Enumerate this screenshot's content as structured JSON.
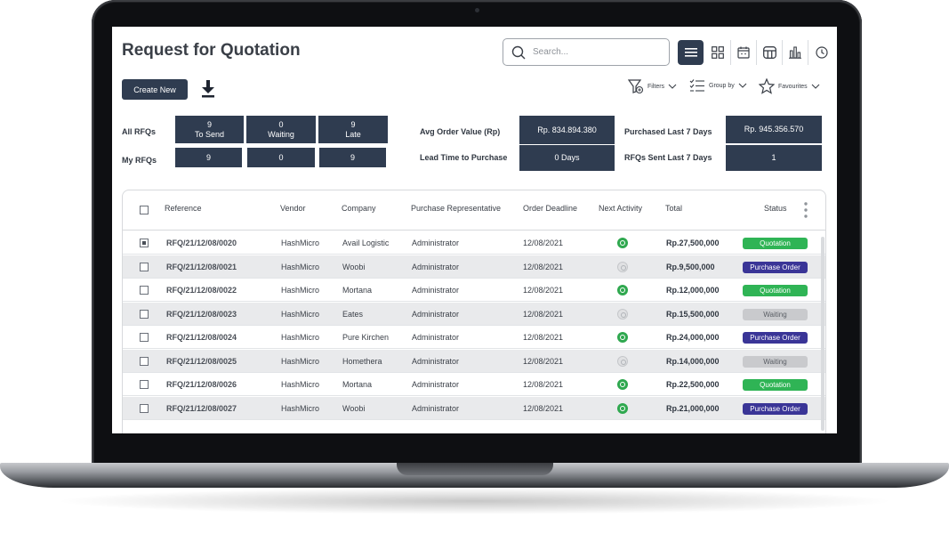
{
  "page": {
    "title": "Request for Quotation",
    "search": {
      "placeholder": "Search..."
    },
    "views": [
      "list-view",
      "kanban-view",
      "calendar-view",
      "pivot-view",
      "graph-view",
      "activity-view"
    ],
    "create_label": "Create New",
    "toolbar": {
      "filters": "Filters",
      "group_by": "Group by",
      "favourites": "Favourites"
    }
  },
  "kpis": {
    "all_rfqs_label": "All RFQs",
    "my_rfqs_label": "My RFQs",
    "all": [
      {
        "count": "9",
        "label": "To Send"
      },
      {
        "count": "0",
        "label": "Waiting"
      },
      {
        "count": "9",
        "label": "Late"
      }
    ],
    "mine": [
      "9",
      "0",
      "9"
    ],
    "avg_order_label": "Avg Order Value (Rp)",
    "avg_order_value": "Rp. 834.894.380",
    "lead_time_label": "Lead Time to Purchase",
    "lead_time_value": "0 Days",
    "purchased_label": "Purchased Last 7 Days",
    "purchased_value": "Rp. 945.356.570",
    "rfqs_sent_label": "RFQs Sent Last 7 Days",
    "rfqs_sent_value": "1"
  },
  "table": {
    "headers": {
      "reference": "Reference",
      "vendor": "Vendor",
      "company": "Company",
      "rep": "Purchase Representative",
      "deadline": "Order Deadline",
      "activity": "Next Activity",
      "total": "Total",
      "status": "Status"
    },
    "rows": [
      {
        "ref": "RFQ/21/12/08/0020",
        "vendor": "HashMicro",
        "company": "Avail Logistic",
        "rep": "Administrator",
        "deadline": "12/08/2021",
        "activity": "on",
        "total": "Rp.27,500,000",
        "status": "Quotation",
        "checked": true
      },
      {
        "ref": "RFQ/21/12/08/0021",
        "vendor": "HashMicro",
        "company": "Woobi",
        "rep": "Administrator",
        "deadline": "12/08/2021",
        "activity": "off",
        "total": "Rp.9,500,000",
        "status": "Purchase Order",
        "checked": false
      },
      {
        "ref": "RFQ/21/12/08/0022",
        "vendor": "HashMicro",
        "company": "Mortana",
        "rep": "Administrator",
        "deadline": "12/08/2021",
        "activity": "on",
        "total": "Rp.12,000,000",
        "status": "Quotation",
        "checked": false
      },
      {
        "ref": "RFQ/21/12/08/0023",
        "vendor": "HashMicro",
        "company": "Eates",
        "rep": "Administrator",
        "deadline": "12/08/2021",
        "activity": "off",
        "total": "Rp.15,500,000",
        "status": "Waiting",
        "checked": false
      },
      {
        "ref": "RFQ/21/12/08/0024",
        "vendor": "HashMicro",
        "company": "Pure Kirchen",
        "rep": "Administrator",
        "deadline": "12/08/2021",
        "activity": "on",
        "total": "Rp.24,000,000",
        "status": "Purchase Order",
        "checked": false
      },
      {
        "ref": "RFQ/21/12/08/0025",
        "vendor": "HashMicro",
        "company": "Homethera",
        "rep": "Administrator",
        "deadline": "12/08/2021",
        "activity": "off",
        "total": "Rp.14,000,000",
        "status": "Waiting",
        "checked": false
      },
      {
        "ref": "RFQ/21/12/08/0026",
        "vendor": "HashMicro",
        "company": "Mortana",
        "rep": "Administrator",
        "deadline": "12/08/2021",
        "activity": "on",
        "total": "Rp.22,500,000",
        "status": "Quotation",
        "checked": false
      },
      {
        "ref": "RFQ/21/12/08/0027",
        "vendor": "HashMicro",
        "company": "Woobi",
        "rep": "Administrator",
        "deadline": "12/08/2021",
        "activity": "on",
        "total": "Rp.21,000,000",
        "status": "Purchase Order",
        "checked": false
      }
    ]
  },
  "colors": {
    "primary": "#2f3c50",
    "quotation": "#2fb455",
    "purchase_order": "#3a3597",
    "waiting": "#c9cacd",
    "activity_on": "#2fa84f"
  }
}
